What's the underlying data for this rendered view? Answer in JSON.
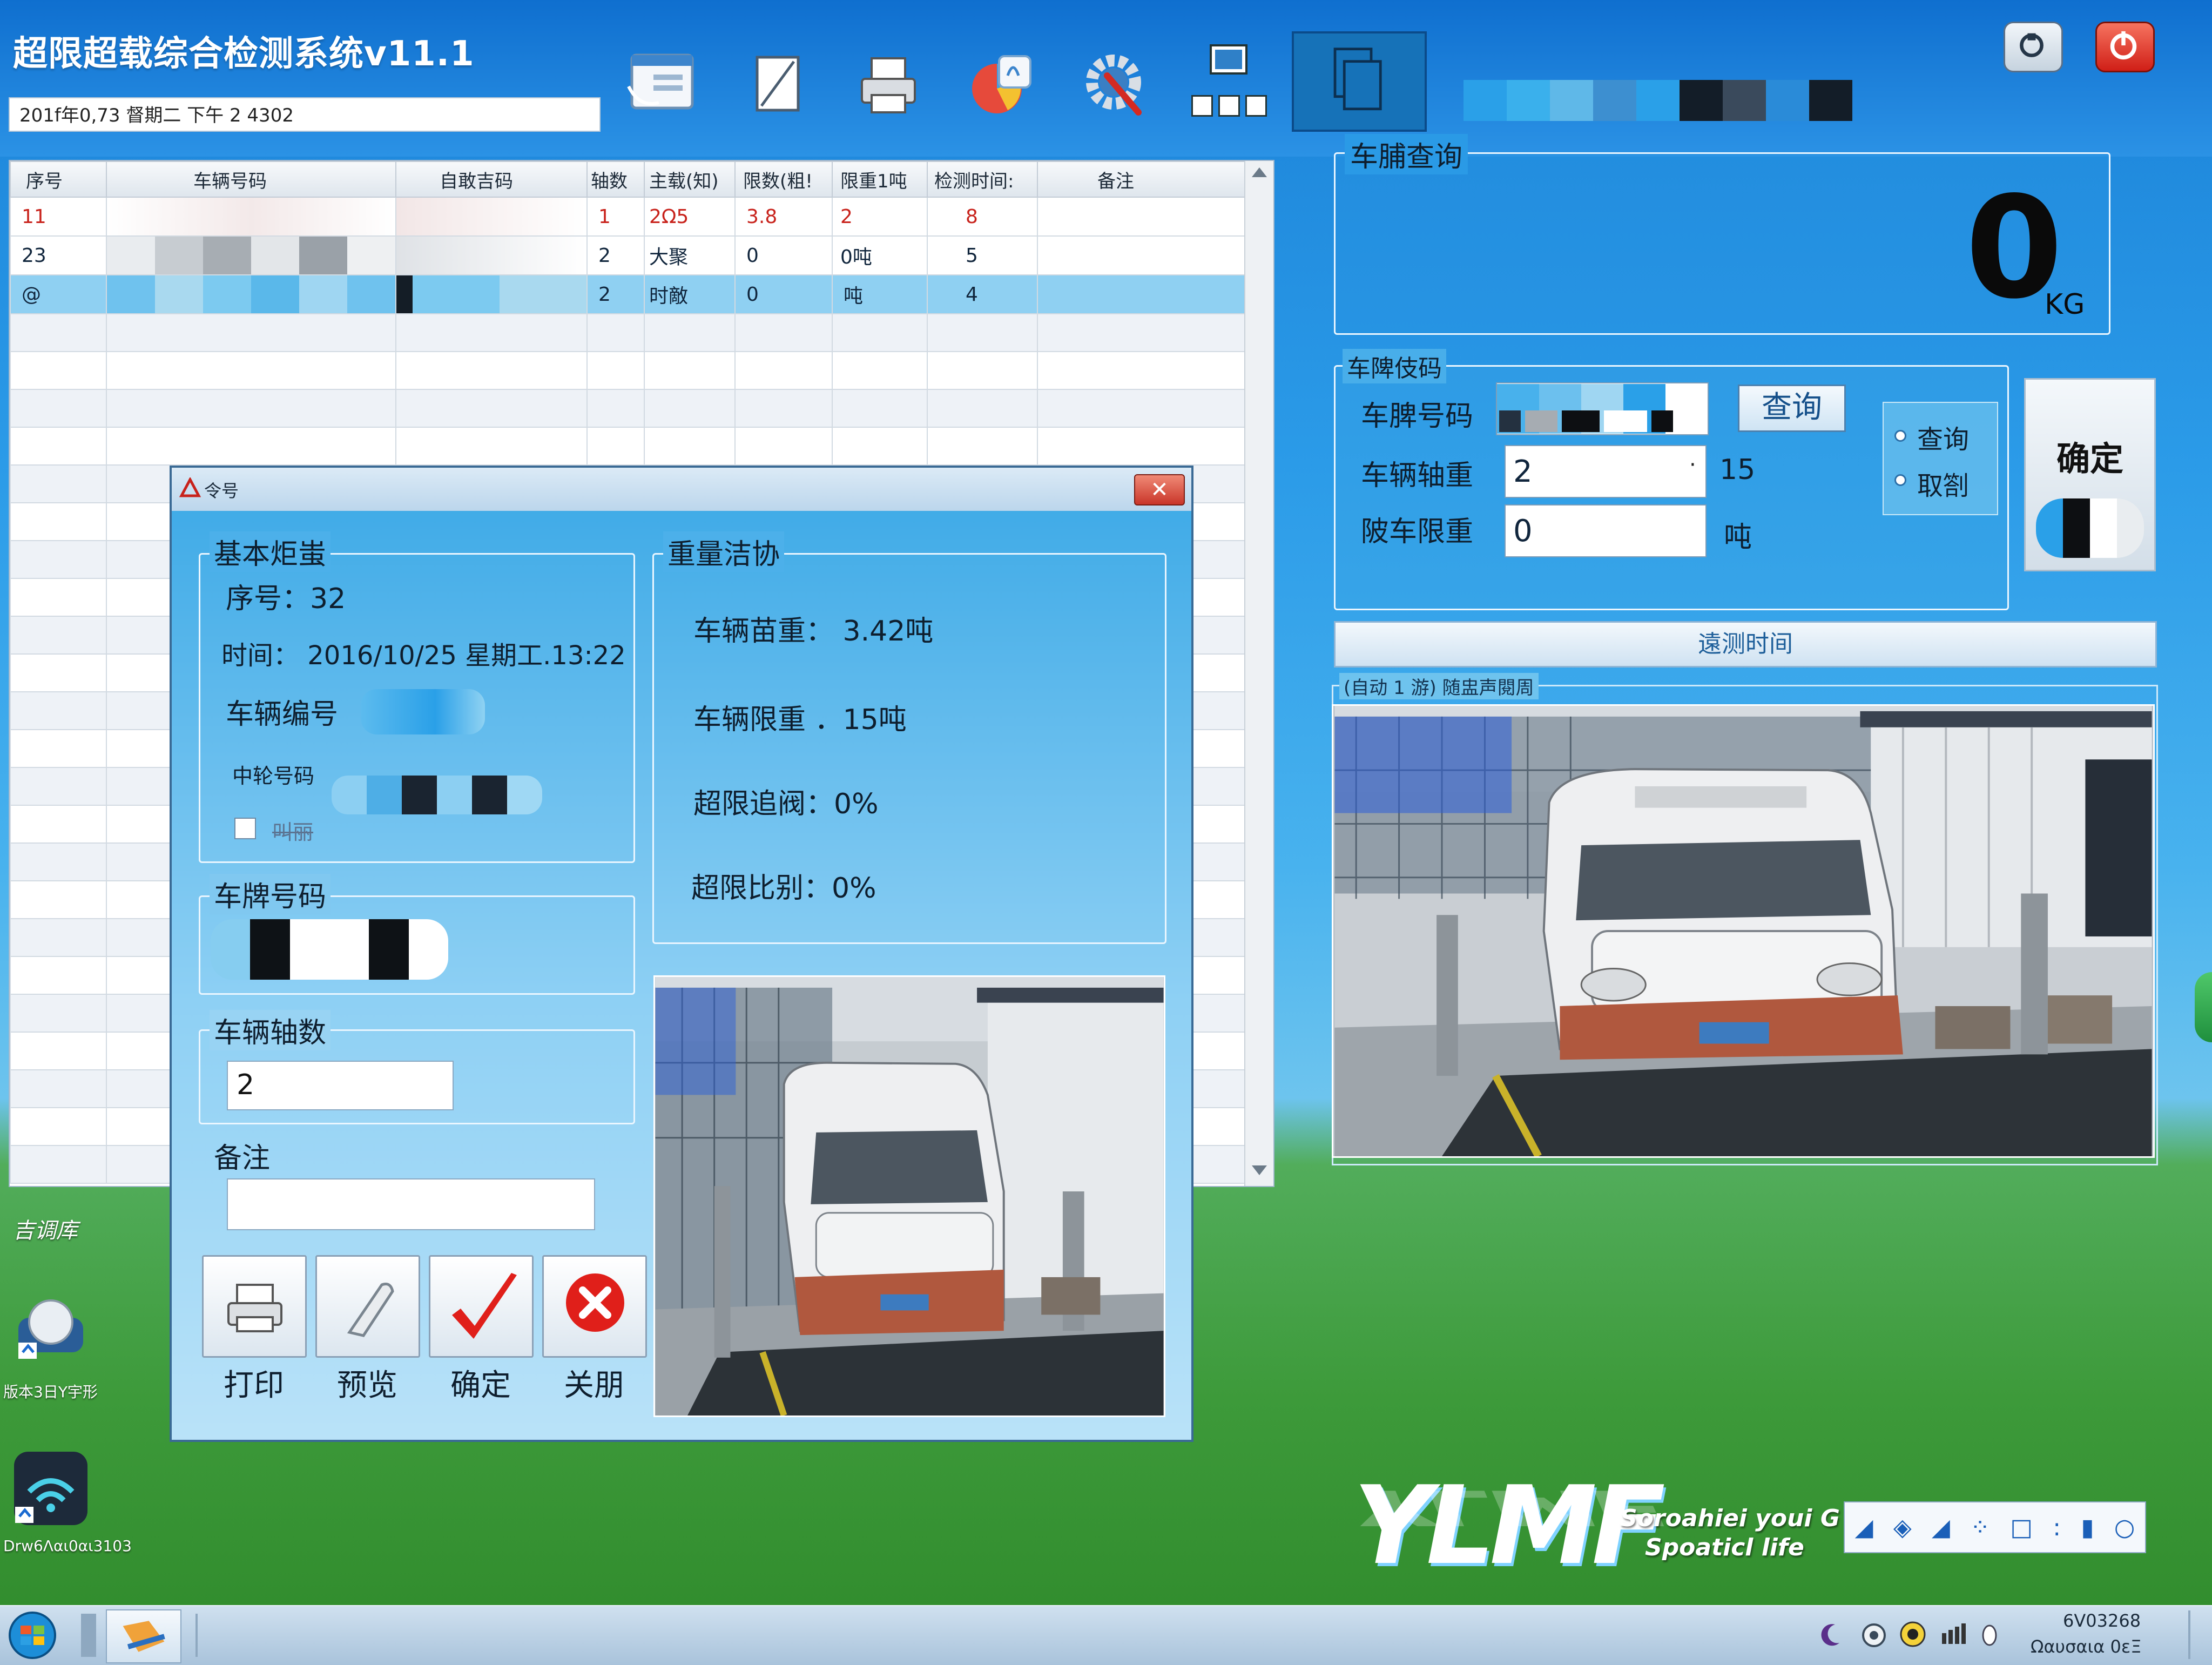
{
  "app": {
    "title": "超限超载综合检测系统v11.1",
    "datetime": "201f年0,73 督期二 下午 2 4302"
  },
  "toolbar": {
    "icons": [
      "records-icon",
      "edit-icon",
      "printer-icon",
      "stats-icon",
      "settings-icon",
      "monitor-icon",
      "window-icon",
      "document-icon"
    ]
  },
  "window_buttons": {
    "minimize_icon": "restore-icon",
    "close_icon": "power-icon"
  },
  "table": {
    "columns": [
      "序号",
      "车辆号码",
      "自敢吉码",
      "轴数",
      "主载(知)",
      "限数(粗!",
      "限重1吨",
      "检测时间:",
      "备注"
    ],
    "rows": [
      {
        "seq": "11",
        "axles": "1",
        "load": "2Ω5",
        "limit_ratio": "3.8",
        "limit_weight": "2",
        "time": "8",
        "note": "",
        "style": "red"
      },
      {
        "seq": "23",
        "axles": "2",
        "load": "大聚",
        "limit_ratio": "0",
        "limit_weight": "0吨",
        "time": "5",
        "note": "",
        "style": "normal"
      },
      {
        "seq": "@",
        "axles": "2",
        "load": "时敵",
        "limit_ratio": "0",
        "limit_weight": "吨",
        "time": "4",
        "note": "",
        "style": "selected"
      }
    ]
  },
  "dialog": {
    "title": "令号",
    "basic_info": {
      "legend": "基本炬蚩",
      "seq": "序号：32",
      "time": "时间：  2016/10/25  星期工.13:22",
      "vehicle_no_label": "车辆编号",
      "plate_label": "中轮号码",
      "checkbox_label": "叫丽"
    },
    "plate": {
      "legend": "车牌号码"
    },
    "axles": {
      "legend": "车辆轴数",
      "value": "2"
    },
    "note": {
      "legend": "备注",
      "value": ""
    },
    "weight": {
      "legend": "重量洁协",
      "total": "车辆苗重：  3.42吨",
      "limit": "车辆限重  ．15吨",
      "threshold": "超限追阀：0%",
      "ratio": "超限比别：0%"
    },
    "buttons": [
      {
        "label": "打印",
        "icon": "printer-icon"
      },
      {
        "label": "预览",
        "icon": "preview-icon"
      },
      {
        "label": "确定",
        "icon": "checkmark-icon"
      },
      {
        "label": "关朋",
        "icon": "close-icon"
      }
    ]
  },
  "right": {
    "weight_group_title": "车脯查询",
    "weight_value": "0",
    "weight_unit": "KG",
    "query_group_title": "车陴伎码",
    "plate_label": "车脾号码",
    "axle_weight_label": "车辆轴重",
    "axle_weight_value": "2",
    "axle_weight_unit": "15",
    "limit_label": "陂车限重",
    "limit_value": "0",
    "limit_unit": "吨",
    "query_button": "查询",
    "radio_query": "查询",
    "radio_cancel": "取劄",
    "confirm_button": "确定",
    "detect_time_bar": "遠测时间",
    "camera_title": "(自动 1 游) 随盅声閱周"
  },
  "desktop": {
    "icons": [
      {
        "label": "吉调库",
        "icon": "folder-icon"
      },
      {
        "label": "版本3日Y宇形",
        "icon": "globe-icon"
      },
      {
        "label": "Drw6Λαι0αι3103",
        "icon": "wifi-icon"
      }
    ],
    "brand_logo": "YLMF",
    "slogan_line1": "Soroahiei youi G",
    "slogan_line2": "Spoaticl life"
  },
  "taskbar": {
    "clock_time": "6V03268",
    "clock_date": "Ωαυσαια 0εΞ"
  },
  "colors": {
    "accent": "#1b82d8",
    "selected_row": "#8fd0f2",
    "red_text": "#c8221b"
  }
}
